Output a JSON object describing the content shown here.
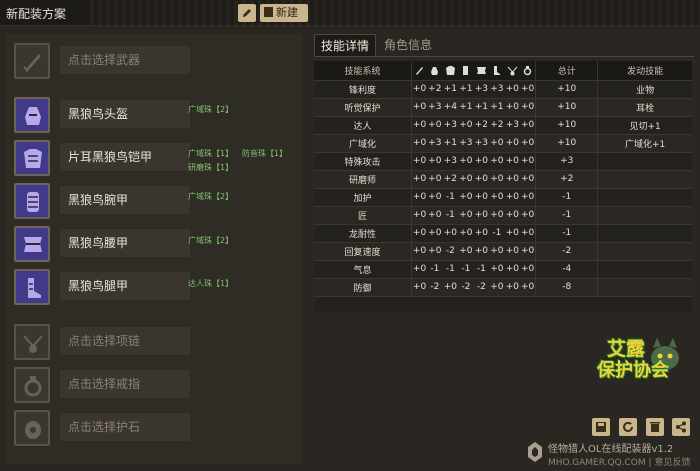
{
  "header": {
    "plan_title": "新配装方案",
    "edit_icon": "pencil-icon",
    "new_label": "新建"
  },
  "equipment": {
    "weapon": {
      "label": "点击选择武器",
      "icon": "sword-icon"
    },
    "head": {
      "label": "黑狼鸟头盔",
      "icon": "helmet-icon",
      "gems": [
        "广域珠【2】"
      ]
    },
    "chest": {
      "label": "片耳黑狼鸟铠甲",
      "icon": "chest-armor-icon",
      "gems": [
        "广域珠【1】",
        "防音珠【1】",
        "研磨珠【1】"
      ]
    },
    "arms": {
      "label": "黑狼鸟腕甲",
      "icon": "gauntlet-icon",
      "gems": [
        "广域珠【2】"
      ]
    },
    "waist": {
      "label": "黑狼鸟腰甲",
      "icon": "waist-armor-icon",
      "gems": [
        "广域珠【2】"
      ]
    },
    "legs": {
      "label": "黑狼鸟腿甲",
      "icon": "greaves-icon",
      "gems": [
        "达人珠【1】"
      ]
    },
    "charm": {
      "label": "点击选择项链",
      "icon": "charm-icon"
    },
    "ring": {
      "label": "点击选择戒指",
      "icon": "ring-icon"
    },
    "stone": {
      "label": "点击选择护石",
      "icon": "talisman-icon"
    }
  },
  "tabs": {
    "skills": "技能详情",
    "character": "角色信息"
  },
  "table": {
    "col_skill": "技能系统",
    "col_total": "总计",
    "col_active": "发动技能",
    "slot_icons": [
      "sword-icon",
      "helmet-icon",
      "chest-armor-icon",
      "gauntlet-icon",
      "waist-armor-icon",
      "greaves-icon",
      "charm-icon",
      "ring-icon"
    ],
    "rows": [
      {
        "name": "锋利度",
        "vals": [
          "+0",
          "+2",
          "+1",
          "+1",
          "+3",
          "+3",
          "+0",
          "+0"
        ],
        "total": "+10",
        "active": "业物"
      },
      {
        "name": "听觉保护",
        "vals": [
          "+0",
          "+3",
          "+4",
          "+1",
          "+1",
          "+1",
          "+0",
          "+0"
        ],
        "total": "+10",
        "active": "耳栓"
      },
      {
        "name": "达人",
        "vals": [
          "+0",
          "+0",
          "+3",
          "+0",
          "+2",
          "+2",
          "+3",
          "+0"
        ],
        "total": "+10",
        "active": "见切+1"
      },
      {
        "name": "广域化",
        "vals": [
          "+0",
          "+3",
          "+1",
          "+3",
          "+3",
          "+0",
          "+0",
          "+0"
        ],
        "total": "+10",
        "active": "广域化+1"
      },
      {
        "name": "特殊攻击",
        "vals": [
          "+0",
          "+0",
          "+3",
          "+0",
          "+0",
          "+0",
          "+0",
          "+0"
        ],
        "total": "+3",
        "active": ""
      },
      {
        "name": "研磨师",
        "vals": [
          "+0",
          "+0",
          "+2",
          "+0",
          "+0",
          "+0",
          "+0",
          "+0"
        ],
        "total": "+2",
        "active": ""
      },
      {
        "name": "加护",
        "vals": [
          "+0",
          "+0",
          "-1",
          "+0",
          "+0",
          "+0",
          "+0",
          "+0"
        ],
        "total": "-1",
        "active": ""
      },
      {
        "name": "匠",
        "vals": [
          "+0",
          "+0",
          "-1",
          "+0",
          "+0",
          "+0",
          "+0",
          "+0"
        ],
        "total": "-1",
        "active": ""
      },
      {
        "name": "龙耐性",
        "vals": [
          "+0",
          "+0",
          "+0",
          "+0",
          "+0",
          "-1",
          "+0",
          "+0"
        ],
        "total": "-1",
        "active": ""
      },
      {
        "name": "回复速度",
        "vals": [
          "+0",
          "+0",
          "-2",
          "+0",
          "+0",
          "+0",
          "+0",
          "+0"
        ],
        "total": "-2",
        "active": ""
      },
      {
        "name": "气息",
        "vals": [
          "+0",
          "-1",
          "-1",
          "-1",
          "-1",
          "+0",
          "+0",
          "+0"
        ],
        "total": "-4",
        "active": ""
      },
      {
        "name": "防御",
        "vals": [
          "+0",
          "-2",
          "+0",
          "-2",
          "-2",
          "+0",
          "+0",
          "+0"
        ],
        "total": "-8",
        "active": ""
      }
    ]
  },
  "logo": {
    "line1": "艾露",
    "line2": "保护协会"
  },
  "tools": [
    "save-icon",
    "refresh-icon",
    "trash-icon",
    "share-icon"
  ],
  "footer": {
    "title": "怪物猎人OL在线配装器v1.2",
    "site": "MHO.GAMER.QQ.COM",
    "sep": "|",
    "feedback": "意见反馈"
  }
}
